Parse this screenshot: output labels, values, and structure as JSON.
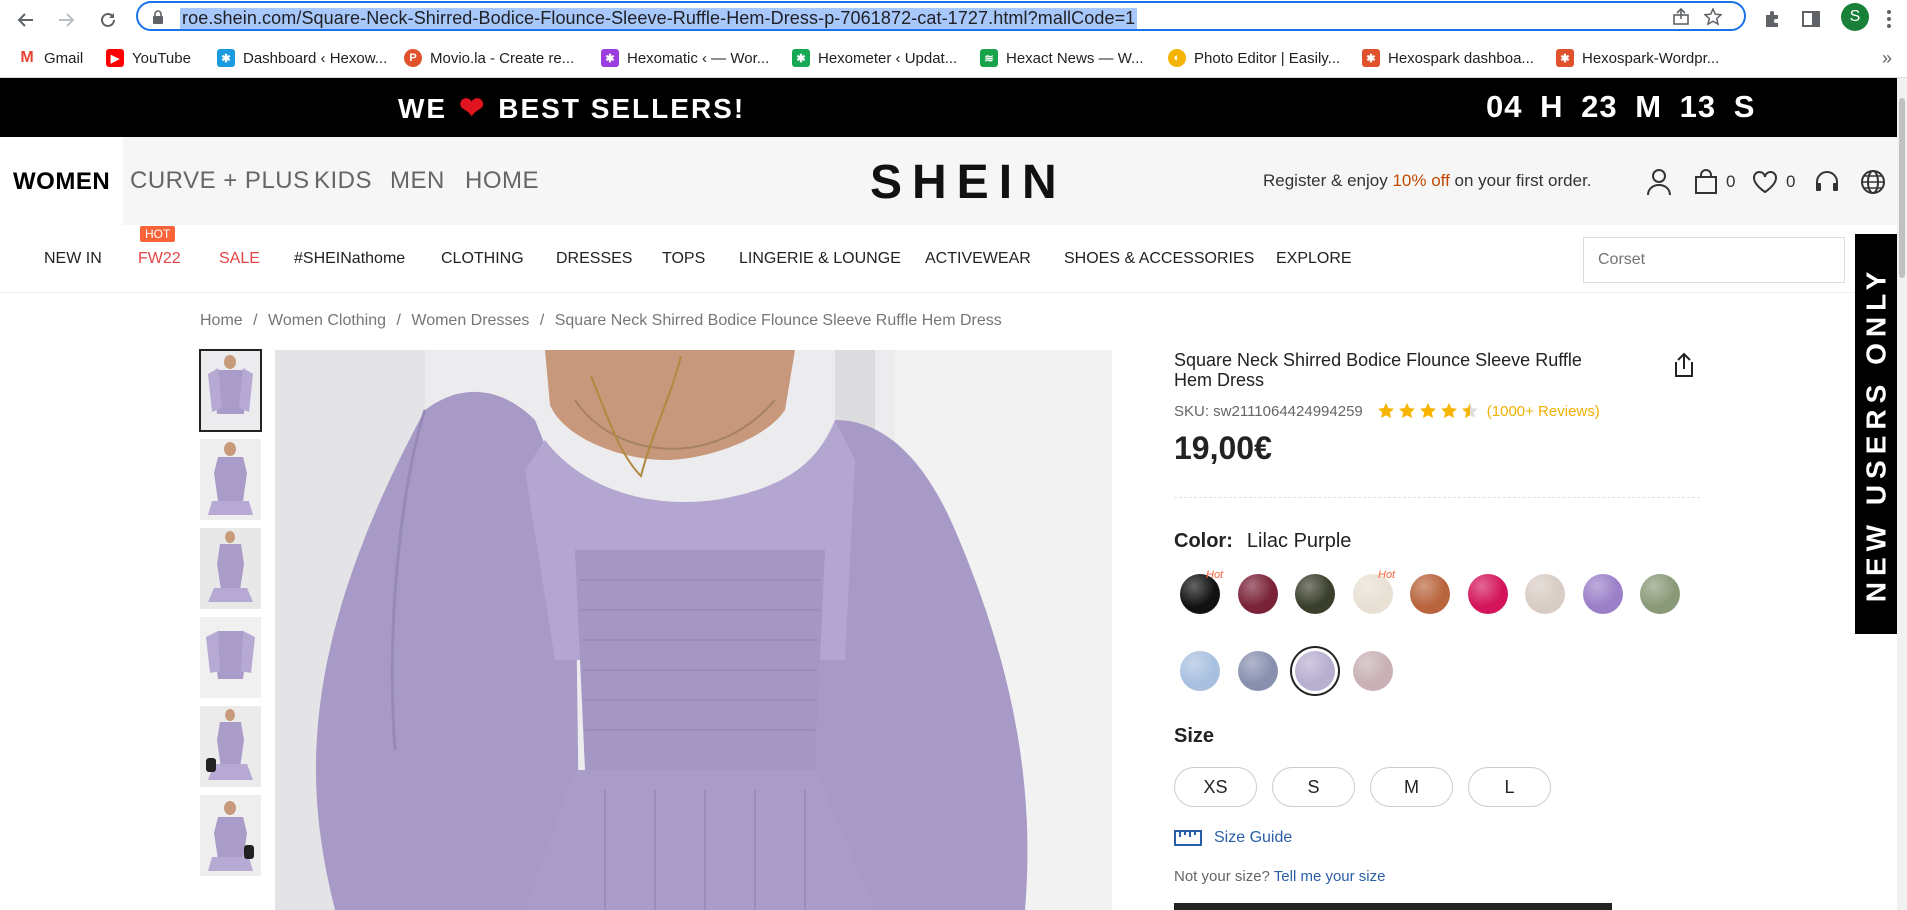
{
  "browser": {
    "url": "roe.shein.com/Square-Neck-Shirred-Bodice-Flounce-Sleeve-Ruffle-Hem-Dress-p-7061872-cat-1727.html?mallCode=1",
    "profile_initial": "S",
    "bookmarks": [
      {
        "label": "Gmail",
        "icon": "gmail-icon",
        "color": "#ea4335"
      },
      {
        "label": "YouTube",
        "icon": "youtube-icon",
        "color": "#ff0000"
      },
      {
        "label": "Dashboard ‹ Hexow...",
        "icon": "hexowatch-icon",
        "color": "#1a9be0"
      },
      {
        "label": "Movio.la - Create re...",
        "icon": "movio-icon",
        "color": "#e0522b"
      },
      {
        "label": "Hexomatic ‹ — Wor...",
        "icon": "hexomatic-icon",
        "color": "#9b3de0"
      },
      {
        "label": "Hexometer ‹ Updat...",
        "icon": "hexometer-icon",
        "color": "#18a957"
      },
      {
        "label": "Hexact News — W...",
        "icon": "hexact-icon",
        "color": "#17a34a"
      },
      {
        "label": "Photo Editor | Easily...",
        "icon": "photo-editor-icon",
        "color": "#f4b400"
      },
      {
        "label": "Hexospark dashboa...",
        "icon": "hexospark-icon",
        "color": "#e0522b"
      },
      {
        "label": "Hexospark-Wordpr...",
        "icon": "hexospark-wp-icon",
        "color": "#e0522b"
      }
    ]
  },
  "promo": {
    "left": "WE",
    "right": "BEST SELLERS!",
    "countdown": "04 H 23 M 13 S"
  },
  "header": {
    "categories": [
      "WOMEN",
      "CURVE + PLUS",
      "KIDS",
      "MEN",
      "HOME"
    ],
    "logo": "SHEIN",
    "register_pre": "Register & enjoy ",
    "register_off": "10% off",
    "register_post": " on your first order.",
    "cart_count": "0",
    "wishlist_count": "0"
  },
  "subnav": {
    "items": [
      "NEW IN",
      "FW22",
      "SALE",
      "#SHEINathome",
      "CLOTHING",
      "DRESSES",
      "TOPS",
      "LINGERIE & LOUNGE",
      "ACTIVEWEAR",
      "SHOES & ACCESSORIES",
      "EXPLORE"
    ],
    "hot_tag": "HOT",
    "search_placeholder": "Corset"
  },
  "side_banner": "NEW USERS ONLY",
  "breadcrumb": [
    "Home",
    "/",
    "Women Clothing",
    "/",
    "Women Dresses",
    "/",
    "Square Neck Shirred Bodice Flounce Sleeve Ruffle Hem Dress"
  ],
  "product": {
    "title": "Square Neck Shirred Bodice Flounce Sleeve Ruffle Hem Dress",
    "sku": "SKU: sw2111064424994259",
    "rating": 4.5,
    "reviews": "(1000+ Reviews)",
    "price": "19,00€",
    "color_label": "Color:",
    "color_value": "Lilac Purple",
    "swatch_hot": "Hot",
    "swatches": [
      "#111111",
      "#7a2238",
      "#3a3f2c",
      "#e8e0d4",
      "#b8643c",
      "#d4145a",
      "#d8ccc4",
      "#9b7fc8",
      "#8a9a78",
      "#a8c0e0",
      "#8890b0",
      "#b8aed0",
      "#c8b0b4"
    ],
    "size_label": "Size",
    "sizes": [
      "XS",
      "S",
      "M",
      "L"
    ],
    "size_guide": "Size Guide",
    "not_your_size": "Not your size?",
    "tell_me": "Tell me your size"
  }
}
